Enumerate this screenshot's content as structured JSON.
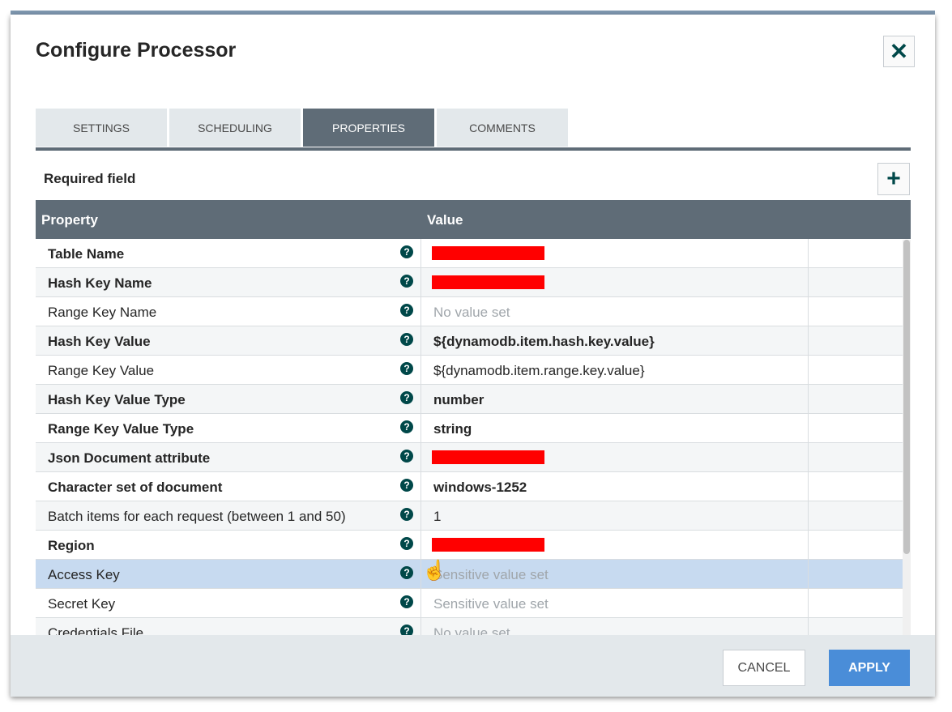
{
  "dialog": {
    "title": "Configure Processor",
    "close_glyph": "✕"
  },
  "tabs": [
    {
      "label": "SETTINGS",
      "active": false
    },
    {
      "label": "SCHEDULING",
      "active": false
    },
    {
      "label": "PROPERTIES",
      "active": true
    },
    {
      "label": "COMMENTS",
      "active": false
    }
  ],
  "properties": {
    "required_label": "Required field",
    "add_glyph": "+",
    "columns": {
      "property": "Property",
      "value": "Value"
    },
    "rows": [
      {
        "name": "Table Name",
        "value": "",
        "required": true,
        "redacted": true
      },
      {
        "name": "Hash Key Name",
        "value": "",
        "required": true,
        "redacted": true
      },
      {
        "name": "Range Key Name",
        "value": "No value set",
        "required": false,
        "muted": true
      },
      {
        "name": "Hash Key Value",
        "value": "${dynamodb.item.hash.key.value}",
        "required": true
      },
      {
        "name": "Range Key Value",
        "value": "${dynamodb.item.range.key.value}",
        "required": false
      },
      {
        "name": "Hash Key Value Type",
        "value": "number",
        "required": true
      },
      {
        "name": "Range Key Value Type",
        "value": "string",
        "required": true
      },
      {
        "name": "Json Document attribute",
        "value": "",
        "required": true,
        "redacted": true
      },
      {
        "name": "Character set of document",
        "value": "windows-1252",
        "required": true
      },
      {
        "name": "Batch items for each request (between 1 and 50)",
        "value": "1",
        "required": false
      },
      {
        "name": "Region",
        "value": "",
        "required": true,
        "redacted": true
      },
      {
        "name": "Access Key",
        "value": "Sensitive value set",
        "required": false,
        "muted": true,
        "selected": true
      },
      {
        "name": "Secret Key",
        "value": "Sensitive value set",
        "required": false,
        "muted": true
      },
      {
        "name": "Credentials File",
        "value": "No value set",
        "required": false,
        "muted": true
      }
    ],
    "help_glyph": "?"
  },
  "footer": {
    "cancel_label": "CANCEL",
    "apply_label": "APPLY"
  },
  "colors": {
    "header_bg": "#5f6c77",
    "accent_teal": "#004849",
    "apply_blue": "#4a8dd8",
    "selected_row": "#c7daf0",
    "redaction": "#ff0000"
  }
}
